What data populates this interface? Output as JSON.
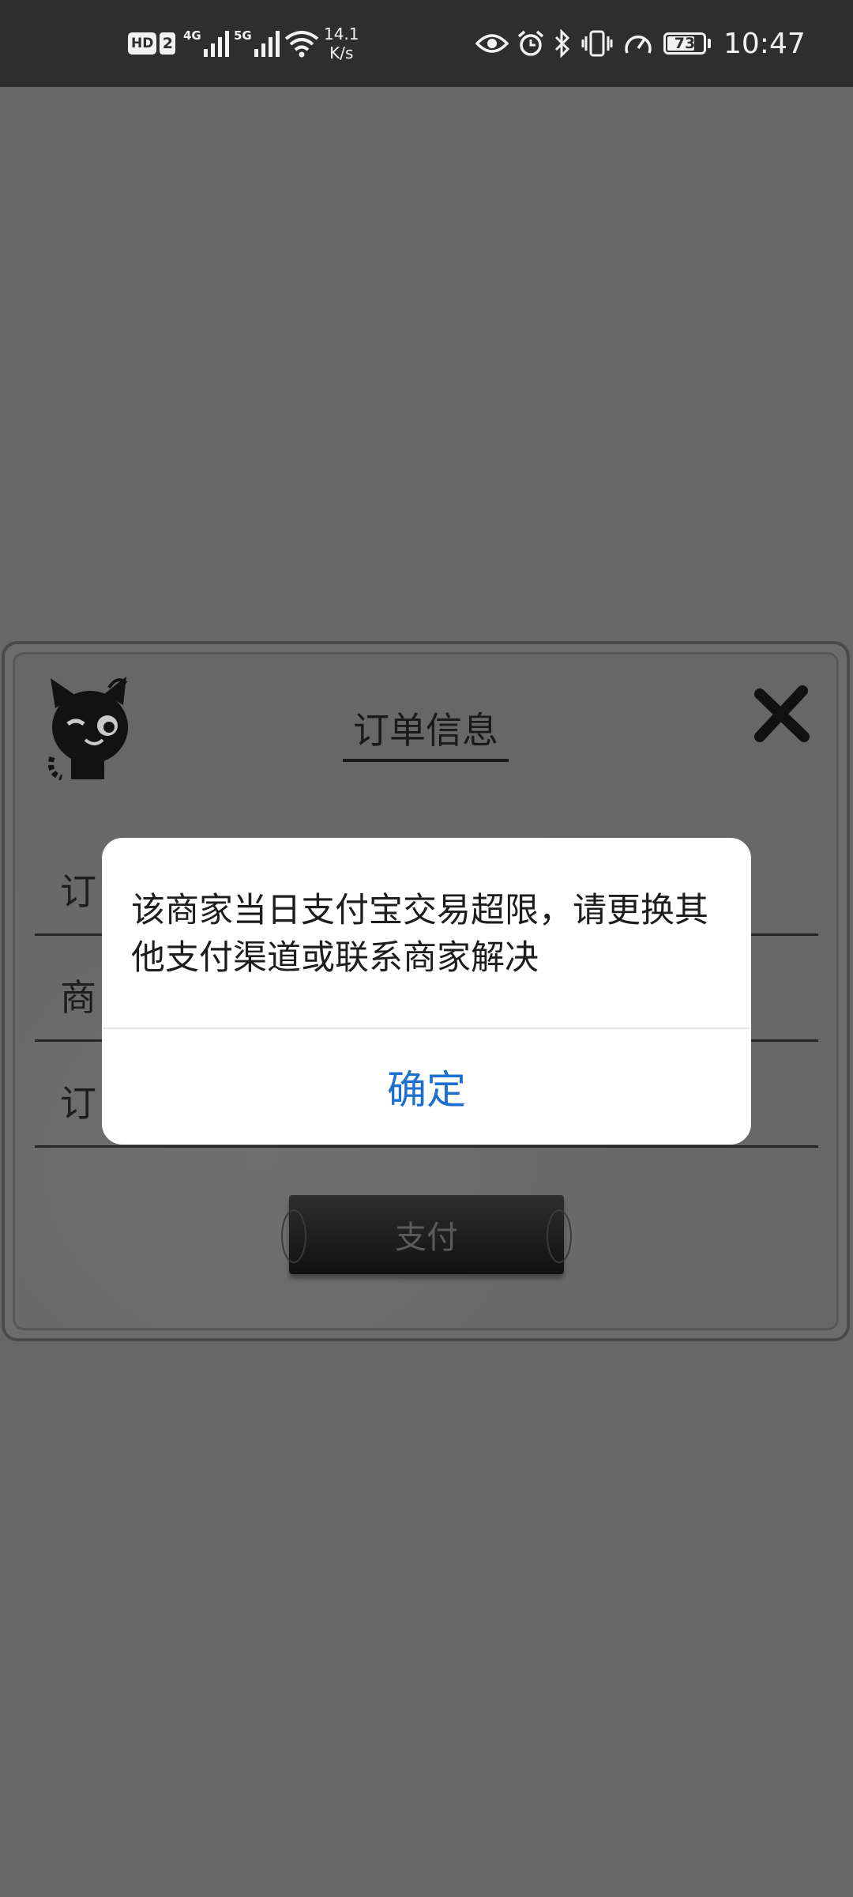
{
  "status_bar": {
    "hd_label": "HD",
    "sim_label": "2",
    "net1_label": "4G",
    "net2_label": "5G",
    "speed_value": "14.1",
    "speed_unit": "K/s",
    "battery_level": "73",
    "time": "10:47"
  },
  "order": {
    "title": "订单信息",
    "field_labels": [
      "订",
      "商",
      "订"
    ],
    "pay_label": "支付"
  },
  "dialog": {
    "message": "该商家当日支付宝交易超限，请更换其他支付渠道或联系商家解决",
    "confirm_label": "确定"
  },
  "colors": {
    "overlay_bg": "#676767",
    "dialog_button": "#1d6fd0"
  }
}
